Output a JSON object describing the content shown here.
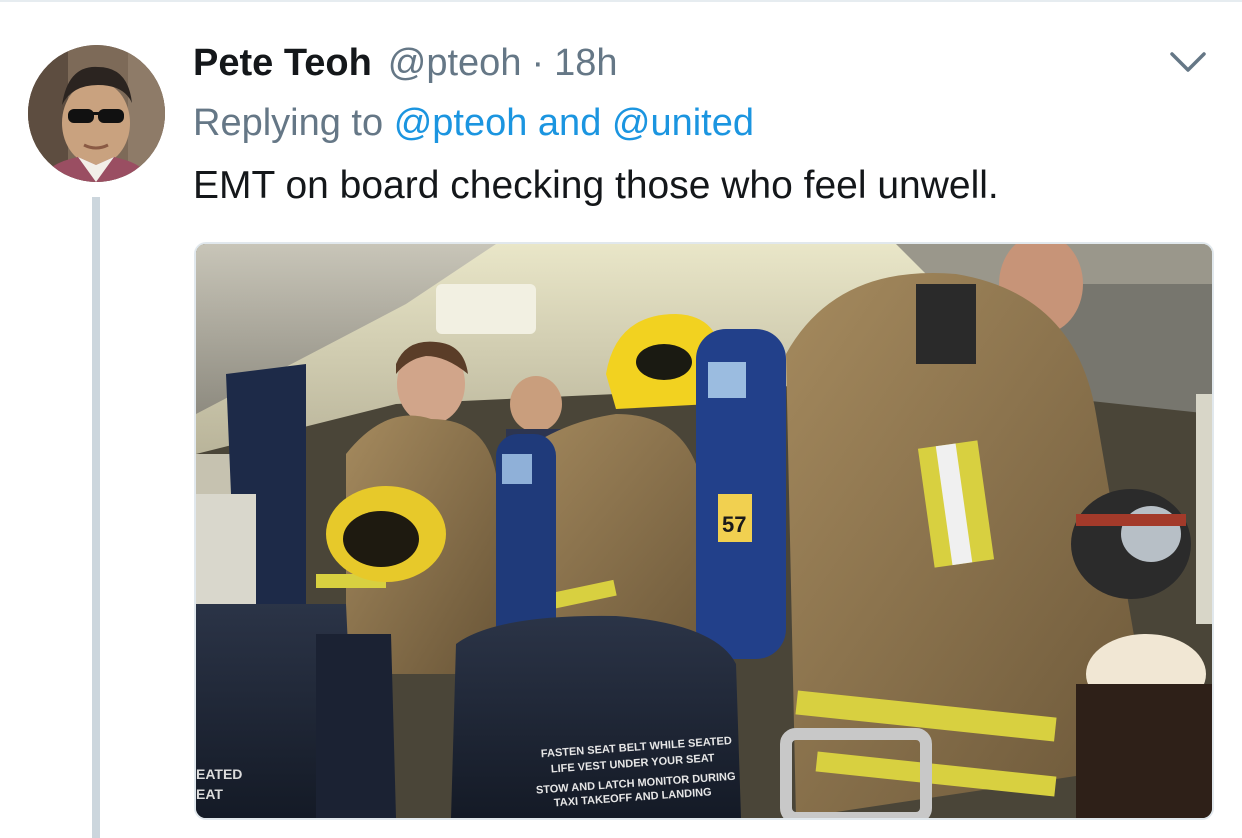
{
  "tweet": {
    "display_name": "Pete Teoh",
    "handle": "@pteoh",
    "separator": "·",
    "timestamp": "18h",
    "replying_prefix": "Replying to",
    "reply_mentions": [
      "@pteoh",
      "@united"
    ],
    "reply_joiner": "and",
    "text": "EMT on board checking those who feel unwell.",
    "photo": {
      "seat_label_lines": [
        "FASTEN SEAT BELT WHILE SEATED",
        "LIFE VEST UNDER YOUR SEAT",
        "STOW AND LATCH MONITOR DURING",
        "TAXI TAKEOFF AND LANDING"
      ],
      "left_seat_label_lines": [
        "EATED",
        "EAT"
      ],
      "tank_number": "57"
    }
  },
  "icons": {
    "more_menu": "chevron-down-icon",
    "avatar": "user-avatar"
  },
  "colors": {
    "text_primary": "#14171a",
    "text_secondary": "#657786",
    "link": "#1b95e0",
    "thread_line": "#ccd6dd"
  }
}
